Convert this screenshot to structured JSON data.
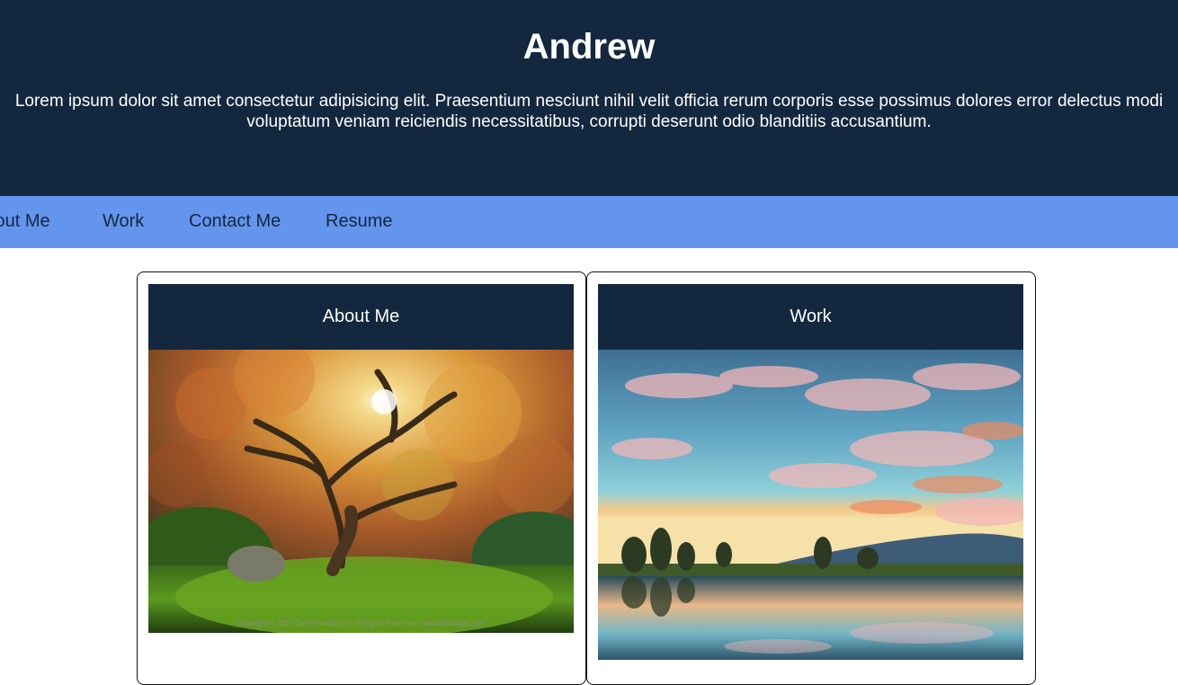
{
  "hero": {
    "title": "Andrew",
    "description": "Lorem ipsum dolor sit amet consectetur adipisicing elit. Praesentium nesciunt nihil velit officia rerum corporis esse possimus dolores error delectus modi voluptatum veniam reiciendis necessitatibus, corrupti deserunt odio blanditiis accusantium."
  },
  "nav": {
    "items": [
      {
        "label": "About Me"
      },
      {
        "label": "Work"
      },
      {
        "label": "Contact Me"
      },
      {
        "label": "Resume"
      }
    ]
  },
  "cards": [
    {
      "title": "About Me",
      "image_caption": "Copyright © 2013 Gavin Hardcastle. All Rights Reserved. www.fototripper.com"
    },
    {
      "title": "Work"
    }
  ],
  "colors": {
    "hero_bg": "#13283f",
    "nav_bg": "#6495ed",
    "nav_text": "#13283f",
    "card_header_bg": "#13283f",
    "text_light": "#ffffff"
  }
}
